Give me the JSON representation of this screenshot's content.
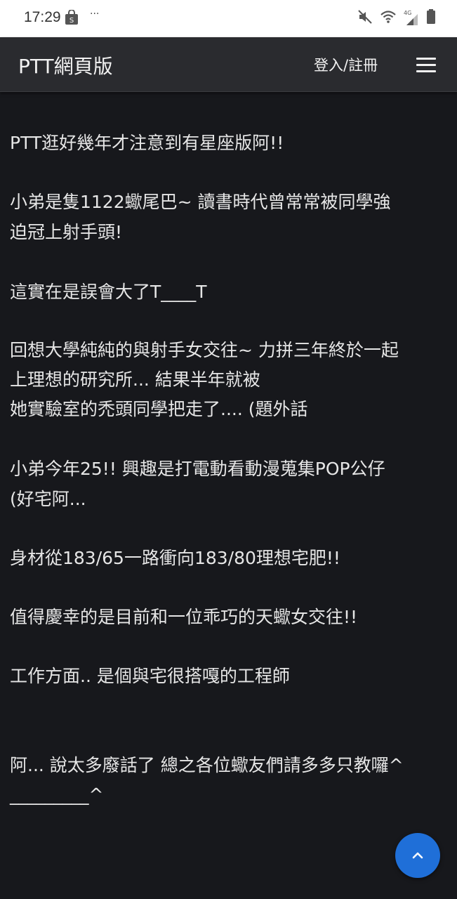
{
  "status_bar": {
    "time": "17:29",
    "dots": "···",
    "network_label": "4G"
  },
  "navbar": {
    "brand": "PTT網頁版",
    "login_label": "登入/註冊"
  },
  "post": {
    "lines": [
      "PTT逛好幾年才注意到有星座版阿!!",
      "小弟是隻1122蠍尾巴~ 讀書時代曾常常被同學強",
      "迫冠上射手頭!",
      "這實在是誤會大了T____T",
      "回想大學純純的與射手女交往~ 力拼三年終於一起",
      "上理想的研究所... 結果半年就被",
      "她實驗室的禿頭同學把走了.... (題外話",
      "小弟今年25!! 興趣是打電動看動漫蒐集POP公仔",
      "(好宅阿...",
      "身材從183/65一路衝向183/80理想宅肥!!",
      "值得慶幸的是目前和一位乖巧的天蠍女交往!!",
      "工作方面.. 是個與宅很搭嘎的工程師",
      "阿... 說太多廢話了  總之各位蠍友們請多多只教囉^",
      "_________^"
    ]
  },
  "colors": {
    "background": "#17181c",
    "navbar": "#2a2b2f",
    "text": "#e6e6e6",
    "accent": "#1f6fd8"
  }
}
